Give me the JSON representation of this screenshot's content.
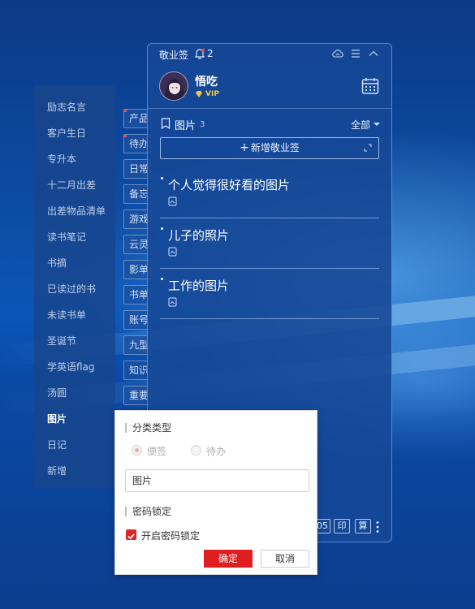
{
  "categories": {
    "items": [
      {
        "label": "励志名言"
      },
      {
        "label": "客户生日"
      },
      {
        "label": "专升本"
      },
      {
        "label": "十二月出差"
      },
      {
        "label": "出差物品清单"
      },
      {
        "label": "读书笔记"
      },
      {
        "label": "书摘"
      },
      {
        "label": "已读过的书"
      },
      {
        "label": "未读书单"
      },
      {
        "label": "圣诞节"
      },
      {
        "label": "学英语flag"
      },
      {
        "label": "汤圆"
      },
      {
        "label": "图片"
      },
      {
        "label": "日记"
      },
      {
        "label": "新增"
      }
    ],
    "active": "图片"
  },
  "tabs": {
    "items": [
      {
        "label": "产品"
      },
      {
        "label": "待办"
      },
      {
        "label": "日常"
      },
      {
        "label": "备忘"
      },
      {
        "label": "游戏"
      },
      {
        "label": "云灵"
      },
      {
        "label": "影单"
      },
      {
        "label": "书单"
      },
      {
        "label": "账号"
      },
      {
        "label": "九型"
      },
      {
        "label": "知识"
      },
      {
        "label": "重要"
      }
    ]
  },
  "window": {
    "app_title": "敬业签",
    "notification_count": "2",
    "user": {
      "name": "悟吃",
      "badge": "VIP"
    },
    "section": {
      "title": "图片",
      "count": "3",
      "filter": "全部"
    },
    "add_button": {
      "plus": "+",
      "label": "新增敬业签"
    },
    "notes": [
      {
        "title": "个人觉得很好看的图片"
      },
      {
        "title": "儿子的照片"
      },
      {
        "title": "工作的图片"
      }
    ],
    "bottom_tools": [
      {
        "label": "05"
      },
      {
        "label": "印"
      },
      {
        "label": "算"
      }
    ]
  },
  "dialog": {
    "type_section": "分类类型",
    "option_note": "便签",
    "option_todo": "待办",
    "name_value": "图片",
    "lock_section": "密码锁定",
    "lock_checkbox_label": "开启密码锁定",
    "lock_checked": true,
    "ok_label": "确定",
    "cancel_label": "取消"
  },
  "colors": {
    "accent_red": "#e01e22",
    "window_bg": "#1a4a96",
    "vip_gold": "#f5c542"
  }
}
